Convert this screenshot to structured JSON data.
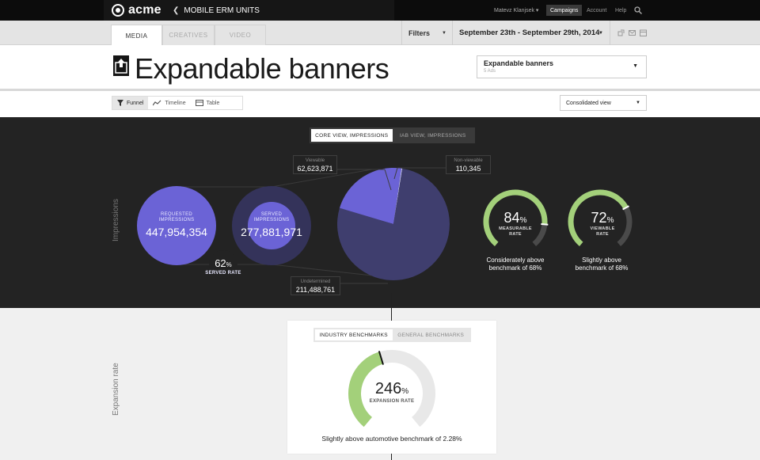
{
  "topbar": {
    "brand": "acme",
    "breadcrumb": "MOBILE ERM UNITS",
    "user": "Matevz Klanjsek",
    "nav": [
      "Campaigns",
      "Account",
      "Help"
    ],
    "active_nav": "Campaigns"
  },
  "tabs": [
    {
      "label": "MEDIA",
      "active": true
    },
    {
      "label": "CREATIVES",
      "active": false
    },
    {
      "label": "VIDEO",
      "active": false
    }
  ],
  "filters_label": "Filters",
  "date_range": "September 23th - September 29th, 2014",
  "title": "Expandable banners",
  "ad_select": {
    "title": "Expandable banners",
    "subtitle": "5 Ads"
  },
  "views": [
    {
      "label": "Funnel",
      "icon": "funnel-icon",
      "active": true
    },
    {
      "label": "Timeline",
      "icon": "timeline-icon",
      "active": false
    },
    {
      "label": "Table",
      "icon": "table-icon",
      "active": false
    }
  ],
  "view_mode": "Consolidated view",
  "impressions": {
    "section_label": "Impressions",
    "toggle": [
      {
        "label": "CORE VIEW, IMPRESSIONS",
        "active": true
      },
      {
        "label": "IAB VIEW, IMPRESSIONS",
        "active": false
      }
    ],
    "requested": {
      "label": "REQUESTED IMPRESSIONS",
      "value": "447,954,354"
    },
    "served": {
      "label": "SERVED IMPRESSIONS",
      "value": "277,881,971"
    },
    "served_rate": {
      "value": "62",
      "unit": "%",
      "label": "SERVED RATE"
    },
    "viewable": {
      "label": "Viewable",
      "value": "62,623,871"
    },
    "non_viewable": {
      "label": "Non-viewable",
      "value": "110,345"
    },
    "undetermined": {
      "label": "Undetermined",
      "value": "211,488,761"
    },
    "gauges": [
      {
        "value": "84",
        "unit": "%",
        "label": "MEASURABLE RATE",
        "caption1": "Considerately above",
        "caption2": "benchmark of 68%"
      },
      {
        "value": "72",
        "unit": "%",
        "label": "VIEWABLE RATE",
        "caption1": "Slightly above",
        "caption2": "benchmark of 68%"
      }
    ]
  },
  "expansion": {
    "section_label": "Expansion rate",
    "toggle": [
      {
        "label": "INDUSTRY BENCHMARKS",
        "active": true
      },
      {
        "label": "GENERAL BENCHMARKS",
        "active": false
      }
    ],
    "value": "246",
    "unit": "%",
    "label": "EXPANSION RATE",
    "caption": "Slightly above automotive benchmark of 2.28%"
  },
  "colors": {
    "accent_purple": "#6b63d6",
    "pie_dark": "#3f3e6e",
    "gauge_green": "#a3d07a",
    "gauge_track": "#4a4a4a"
  },
  "chart_data": {
    "type": "pie",
    "categories": [
      "Viewable",
      "Non-viewable",
      "Undetermined"
    ],
    "values": [
      62623871,
      110345,
      211488761
    ]
  }
}
